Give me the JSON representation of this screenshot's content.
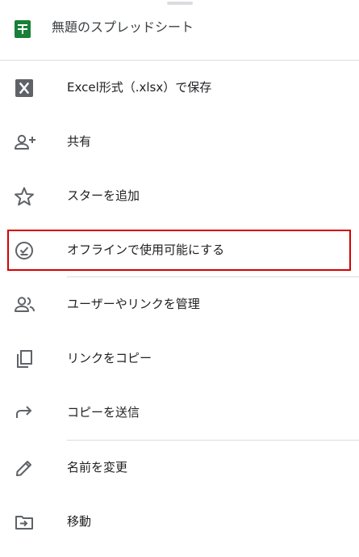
{
  "header": {
    "title": "無題のスプレッドシート",
    "icon": "google-sheets-icon"
  },
  "menu": [
    {
      "label": "Excel形式（.xlsx）で保存",
      "icon": "excel-icon"
    },
    {
      "label": "共有",
      "icon": "person-add-icon"
    },
    {
      "label": "スターを追加",
      "icon": "star-outline-icon"
    },
    {
      "label": "オフラインで使用可能にする",
      "icon": "offline-pin-icon"
    },
    {
      "label": "ユーザーやリンクを管理",
      "icon": "people-icon"
    },
    {
      "label": "リンクをコピー",
      "icon": "copy-icon"
    },
    {
      "label": "コピーを送信",
      "icon": "forward-arrow-icon"
    },
    {
      "label": "名前を変更",
      "icon": "pencil-icon"
    },
    {
      "label": "移動",
      "icon": "move-folder-icon"
    }
  ],
  "colors": {
    "sheets_green": "#188038",
    "highlight_red": "#d50000",
    "icon_gray": "#5f6368"
  }
}
